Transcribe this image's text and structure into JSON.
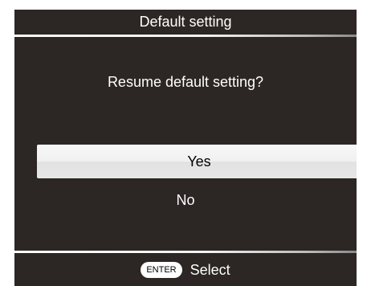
{
  "dialog": {
    "title": "Default setting",
    "question": "Resume default setting?"
  },
  "options": [
    {
      "label": "Yes",
      "selected": true
    },
    {
      "label": "No",
      "selected": false
    }
  ],
  "footer": {
    "key_label": "ENTER",
    "action_label": "Select"
  },
  "colors": {
    "background": "#2c2624",
    "text": "#ffffff",
    "highlight": "#f0f0f0"
  }
}
